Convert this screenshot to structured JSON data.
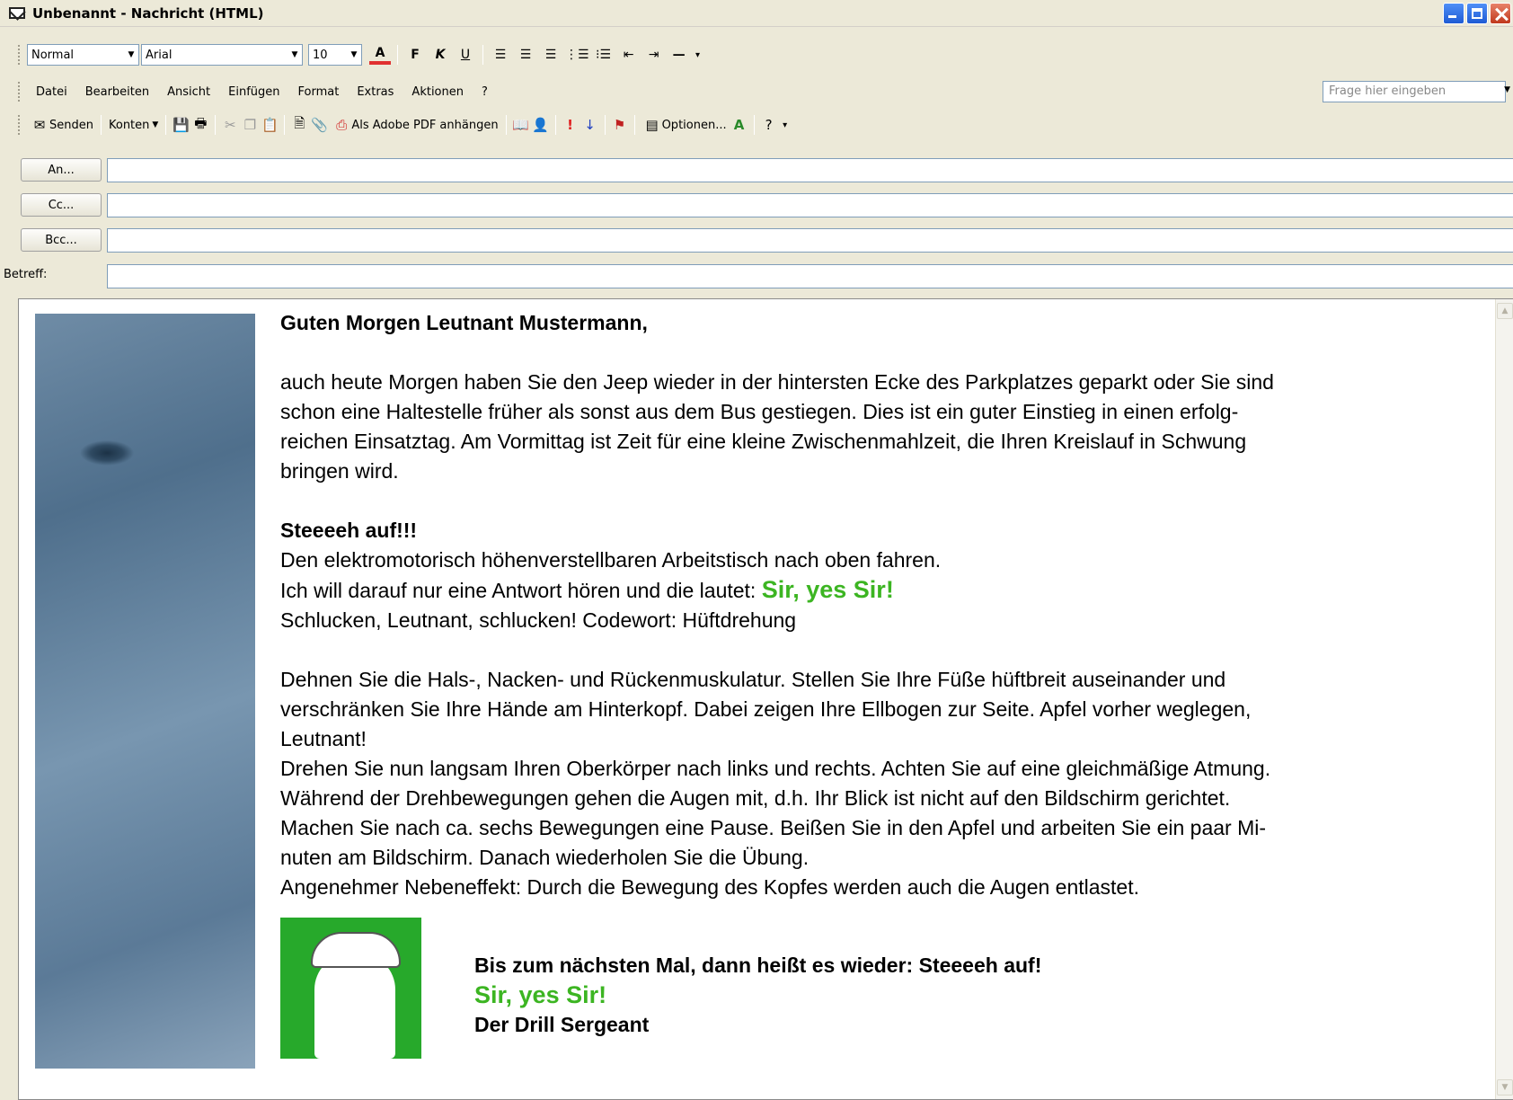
{
  "window": {
    "title": "Unbenannt - Nachricht (HTML)"
  },
  "format_bar": {
    "style": "Normal",
    "font": "Arial",
    "size": "10",
    "bold": "F",
    "italic": "K",
    "underline": "U"
  },
  "menu": {
    "items": [
      "Datei",
      "Bearbeiten",
      "Ansicht",
      "Einfügen",
      "Format",
      "Extras",
      "Aktionen",
      "?"
    ],
    "ask_placeholder": "Frage hier eingeben"
  },
  "standard_bar": {
    "send": "Senden",
    "accounts": "Konten",
    "pdf": "Als Adobe PDF anhängen",
    "options": "Optionen..."
  },
  "header": {
    "to_label": "An...",
    "cc_label": "Cc...",
    "bcc_label": "Bcc...",
    "subject_label": "Betreff:",
    "to_value": "",
    "cc_value": "",
    "bcc_value": "",
    "subject_value": ""
  },
  "message": {
    "greeting": "Guten Morgen Leutnant Mustermann,",
    "para1_l1": "auch heute Morgen haben Sie den Jeep wieder in der hintersten Ecke des Parkplatzes geparkt oder Sie sind",
    "para1_l2": "schon eine Haltestelle früher als sonst aus dem Bus gestiegen. Dies ist ein guter Einstieg in einen erfolg-",
    "para1_l3": "reichen Einsatztag. Am Vormittag ist Zeit für eine kleine Zwischenmahlzeit, die Ihren Kreislauf in Schwung",
    "para1_l4": "bringen wird.",
    "heading": "Steeeeh auf!!!",
    "line_desk": "Den elektromotorisch höhenverstellbaren Arbeitstisch nach oben fahren.",
    "line_answer": "Ich will darauf nur eine Antwort hören und die lautet: ",
    "answer": "Sir, yes Sir!",
    "line_code": "Schlucken, Leutnant, schlucken! Codewort: Hüftdrehung",
    "para2_l1": "Dehnen Sie die  Hals-, Nacken- und Rückenmuskulatur. Stellen Sie Ihre Füße hüftbreit auseinander und",
    "para2_l2": "verschränken Sie Ihre Hände am Hinterkopf. Dabei zeigen Ihre Ellbogen zur Seite. Apfel vorher weglegen,",
    "para2_l3": "Leutnant!",
    "para2_l4": "Drehen Sie nun langsam Ihren Oberkörper nach links und rechts. Achten Sie auf eine gleichmäßige Atmung.",
    "para2_l5": "Während der Drehbewegungen gehen die Augen mit, d.h. Ihr Blick ist nicht auf den Bildschirm gerichtet.",
    "para2_l6": "Machen Sie nach ca. sechs Bewegungen eine Pause. Beißen Sie in den Apfel und arbeiten Sie ein paar Mi-",
    "para2_l7": "nuten am Bildschirm. Danach wiederholen Sie die Übung.",
    "para2_l8": "Angenehmer Nebeneffekt: Durch die Bewegung des Kopfes werden auch die Augen entlastet.",
    "closing": "Bis zum nächsten Mal, dann heißt es wieder: Steeeeh auf!",
    "closing_green": "Sir, yes Sir!",
    "signature": "Der Drill Sergeant"
  },
  "colors": {
    "accent_green": "#3cb522",
    "image_green": "#27a92b"
  }
}
